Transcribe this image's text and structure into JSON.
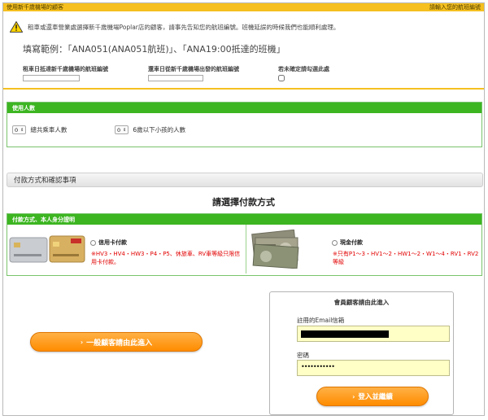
{
  "flight_section": {
    "header_left": "使用新千歲機場的顧客",
    "header_right": "請輸入您的航班編號",
    "notice": "租車或還車營業處選擇新千歲機場Poplar店的顧客，請事先告知您的航班編號。班機延誤的時候我們也能順利處理。",
    "example": "填寫範例：「ANA051(ANA051航班)」、「ANA19:00抵達的班機」",
    "arrival_label": "租車日抵達新千歲機場的航班編號",
    "arrival_value": "",
    "departure_label": "還車日從新千歲機場出發的航班編號",
    "departure_value": "",
    "unsure_label": "若未確定請勾選此處"
  },
  "passengers": {
    "header": "使用人數",
    "total_value": "0",
    "total_label": "總共乘車人數",
    "children_value": "0",
    "children_label": "6歲以下小孩的人數"
  },
  "payment_bar": "付款方式和確認事項",
  "choose_title": "請選擇付款方式",
  "payment": {
    "header": "付款方式、本人身分證明",
    "card_title": "信用卡付款",
    "card_note": "※HV3・HV4・HW3・P4・P5、休旅車、RV車等級只限信用卡付款。",
    "cash_title": "現金付款",
    "cash_note": "※只有P1～3・HV1～2・HW1～2・W1～4・RV1・RV2等級"
  },
  "general_button": "一般顧客請由此進入",
  "login": {
    "title": "會員顧客請由此進入",
    "email_label": "註冊的Email信箱",
    "password_label": "密碼",
    "password_masked": "•••••••••••",
    "submit": "登入並繼續"
  },
  "colors": {
    "yellow_header": "#f5c020",
    "green_header": "#3cb521",
    "orange_button": "#ff8c00",
    "required_red": "#e20000",
    "input_yellow": "#ffffc6"
  },
  "icons": [
    "warning-icon",
    "chevron-right-icon",
    "credit-card-image",
    "yen-bills-image"
  ]
}
